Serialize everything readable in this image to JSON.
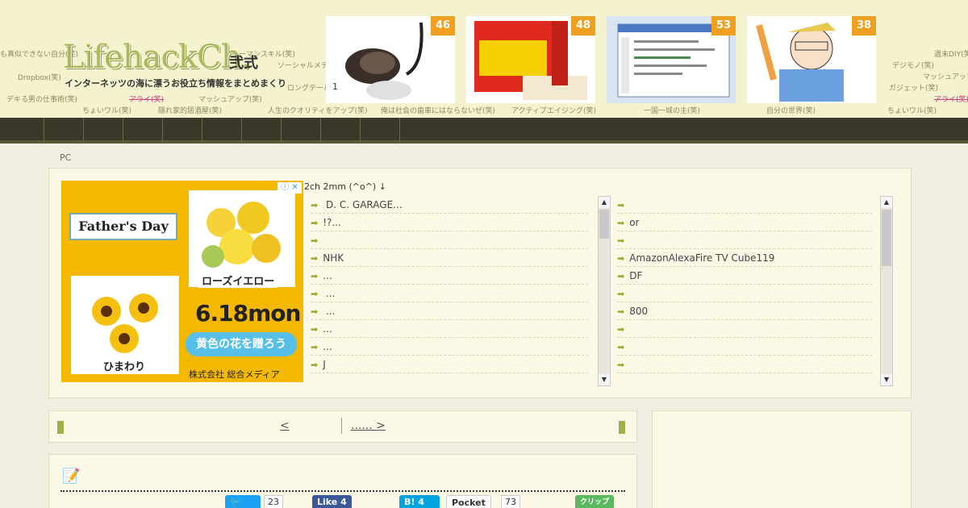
{
  "header": {
    "logo": "LifehackCh.",
    "logo_suffix": "弐式",
    "tagline": "インターネッツの海に漂うお役立ち情報をまとめまくり",
    "tags": [
      "も真似できない自分(笑)",
      "Dropbox(笑)",
      "デキる男の仕事術(笑)",
      "ちょいワル(笑)",
      "隠れ家的居酒屋(笑)",
      "マッシュアップ(笑)",
      "人生のクオリティをアップ(笑)",
      "俺は社会の歯車にはならないぜ(笑)",
      "アクティブエイジング(笑)",
      "一国一城の主(笑)",
      "自分の世界(笑)",
      "ちょいワル(笑)",
      "デジモノ(笑)",
      "週末DIY(笑)",
      "マッシュアップ(笑)",
      "ガジェット(笑)",
      "アライ(笑)",
      "ソーシャルメディ",
      "ロングテール",
      "アライ(笑)",
      "ヒューマンスキル(笑)"
    ],
    "thumbnails": [
      {
        "badge": "46",
        "caption": "1"
      },
      {
        "badge": "48",
        "caption": ""
      },
      {
        "badge": "53",
        "caption": ""
      },
      {
        "badge": "38",
        "caption": ""
      }
    ]
  },
  "breadcrumb": "PC",
  "ad": {
    "banner": "Father's Day",
    "label_rose": "ローズイエロー",
    "label_sunflower": "ひまわり",
    "date": "6.18mon",
    "heart_text": "黄色の花を贈ろう",
    "company": "株式会社 総合メディア",
    "adchoices": "ⓘ ✕"
  },
  "related": {
    "heading": "2ch  2mm (^o^) ↓",
    "left_items": [
      " D. C. GARAGE...",
      "!?...",
      "",
      "NHK",
      "...",
      " ...",
      "  ...",
      "...",
      "...",
      "J"
    ],
    "right_items": [
      "",
      "or",
      "",
      "AmazonAlexaFire TV Cube119",
      "DF",
      "",
      "800",
      "",
      "",
      ""
    ]
  },
  "pager": {
    "prev": "<",
    "next": "...... >"
  },
  "share": {
    "tweet_count": "23",
    "like_label": "Like 4",
    "hatena_label": "B! 4",
    "pocket_label": "Pocket",
    "pocket_count": "73",
    "clip_label": "クリップ"
  }
}
